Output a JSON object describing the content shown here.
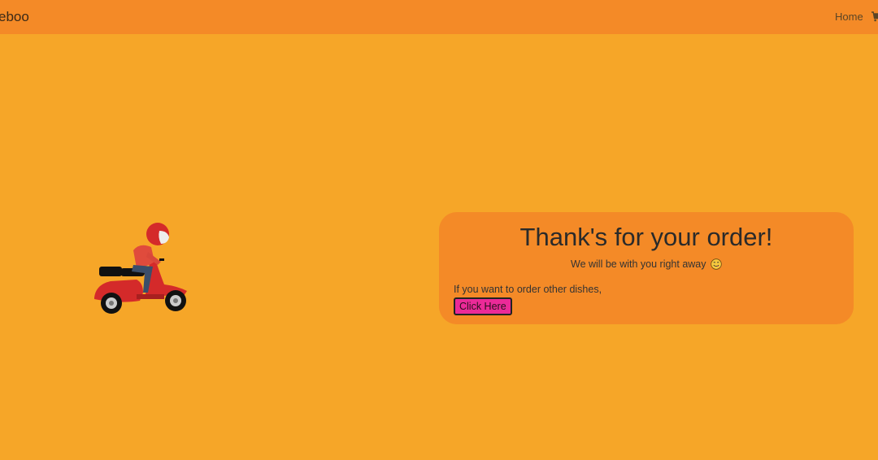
{
  "navbar": {
    "brand": "eboo",
    "home_label": "Home",
    "cart_icon": "cart-icon",
    "background": "#F48A27"
  },
  "page": {
    "background": "#F6A628",
    "illustration": "delivery-scooter-illustration"
  },
  "card": {
    "title": "Thank's for your order!",
    "subtitle": "We will be with you right away",
    "subtitle_emoji": "yum-face-emoji",
    "prompt": "If you want to order other dishes,",
    "button_label": "Click Here",
    "button_color": "#EB2A98",
    "background": "#F48A27"
  }
}
